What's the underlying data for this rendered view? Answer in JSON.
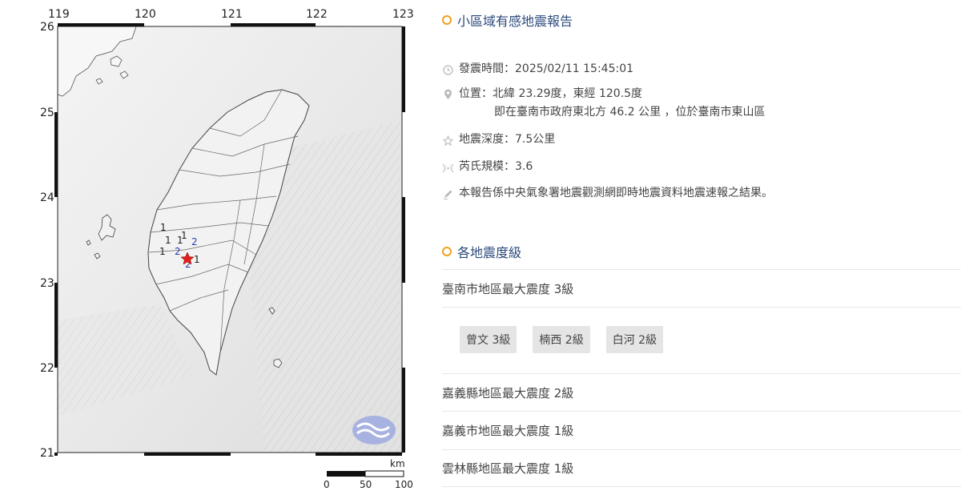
{
  "map": {
    "lon_ticks": [
      "119",
      "120",
      "121",
      "122",
      "123"
    ],
    "lat_ticks": [
      "26",
      "25",
      "24",
      "23",
      "22",
      "21"
    ],
    "epicenter_marker": "red-star",
    "intensity_markers": [
      "1",
      "1",
      "1",
      "1",
      "1",
      "2",
      "2",
      "2",
      "1"
    ],
    "scale": {
      "unit": "km",
      "labels": [
        "0",
        "50",
        "100"
      ]
    },
    "logo": "cwa-logo"
  },
  "report": {
    "title": "小區域有感地震報告",
    "time": "發震時間：2025/02/11 15:45:01",
    "location_line1": "位置：北緯 23.29度，東經 120.5度",
    "location_line2": "即在臺南市政府東北方 46.2 公里 ，位於臺南市東山區",
    "depth": "地震深度：7.5公里",
    "magnitude": "芮氏規模：3.6",
    "note": "本報告係中央氣象署地震觀測網即時地震資料地震速報之結果。"
  },
  "intensity": {
    "title": "各地震度級",
    "regions": [
      {
        "label": "臺南市地區最大震度 3級",
        "stations": [
          "曾文 3級",
          "楠西 2級",
          "白河 2級"
        ]
      },
      {
        "label": "嘉義縣地區最大震度 2級"
      },
      {
        "label": "嘉義市地區最大震度 1級"
      },
      {
        "label": "雲林縣地區最大震度 1級"
      }
    ]
  },
  "colors": {
    "accent_orange": "#f0a020",
    "title_blue": "#2c4a7c",
    "epicenter_red": "#e02020",
    "intensity_blue": "#2a3eb0"
  }
}
